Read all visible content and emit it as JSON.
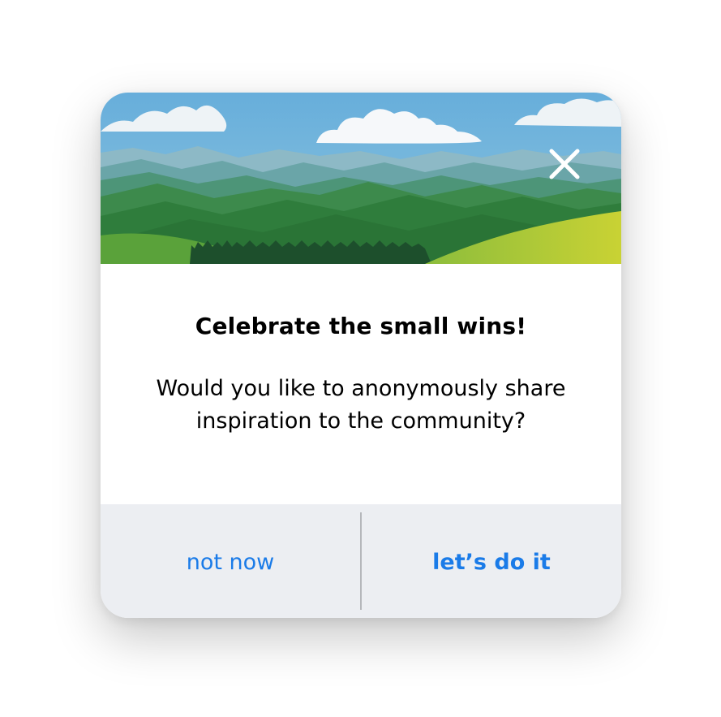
{
  "dialog": {
    "title": "Celebrate the small wins!",
    "message": "Would you like to anonymously share inspiration to the community?",
    "close_icon": "close-icon",
    "hero_image": "mountain-landscape-illustration",
    "actions": {
      "secondary_label": "not now",
      "primary_label": "let’s do it"
    }
  },
  "colors": {
    "accent": "#1a7be8",
    "actions_background": "#eceef2",
    "sky": "#6fb3d9"
  }
}
